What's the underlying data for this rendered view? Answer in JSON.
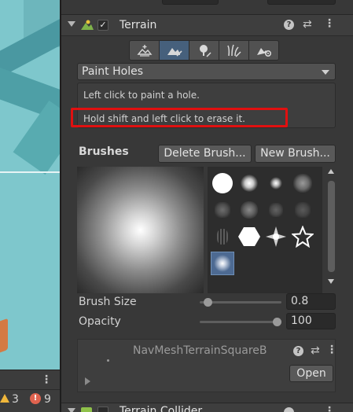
{
  "console": {
    "menu_icon": "kebab-menu-icon",
    "warning_count": "3",
    "error_count": "9",
    "error_glyph": "!"
  },
  "component": {
    "title": "Terrain",
    "enabled_mark": "✓",
    "help_glyph": "?",
    "preset_glyph": "⇄",
    "menu_glyph": "⋮"
  },
  "toolbar": {
    "tools": [
      {
        "name": "create-neighbor-terrains",
        "icon": "terrain-grid-plus-icon",
        "active": false
      },
      {
        "name": "paint-terrain",
        "icon": "terrain-brush-icon",
        "active": true
      },
      {
        "name": "paint-trees",
        "icon": "tree-brush-icon",
        "active": false
      },
      {
        "name": "paint-details",
        "icon": "grass-brush-icon",
        "active": false
      },
      {
        "name": "terrain-settings",
        "icon": "terrain-gear-icon",
        "active": false
      }
    ]
  },
  "tool_dropdown": {
    "selected": "Paint Holes"
  },
  "help": {
    "line1": "Left click to paint a hole.",
    "line2": "Hold shift and left click to erase it."
  },
  "annotation": {
    "color": "#e01010"
  },
  "brushes": {
    "label": "Brushes",
    "delete_label": "Delete Brush...",
    "new_label": "New Brush...",
    "selected_index": 12,
    "count": 13
  },
  "brush_size": {
    "label": "Brush Size",
    "value": "0.8",
    "fraction": 0.05
  },
  "opacity": {
    "label": "Opacity",
    "value": "100",
    "fraction": 1.0
  },
  "asset": {
    "title": "NavMeshTerrainSquareB",
    "open_label": "Open"
  },
  "next_component": {
    "title": "Terrain Collider"
  },
  "colors": {
    "panel_bg": "#383838",
    "active_tool": "#46607c",
    "selected_brush": "#4d6a92",
    "warning": "#f0b73b",
    "error": "#e0634f",
    "scene_water": "#7ec7cc"
  }
}
